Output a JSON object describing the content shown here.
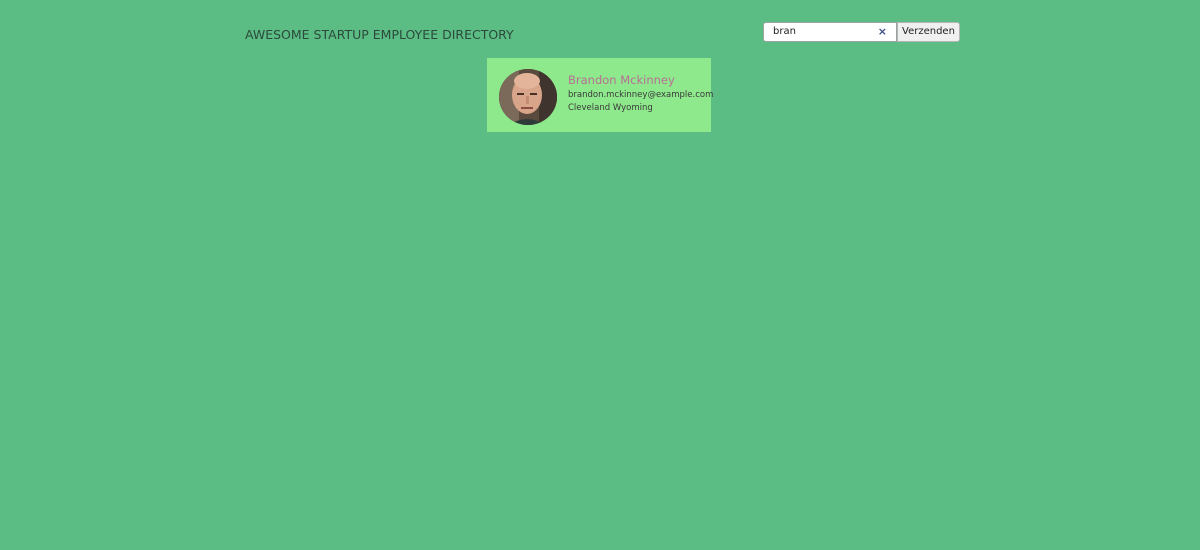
{
  "header": {
    "title": "AWESOME STARTUP EMPLOYEE DIRECTORY"
  },
  "search": {
    "value": "bran",
    "clear_icon": "×",
    "submit_label": "Verzenden"
  },
  "employees": [
    {
      "name": "Brandon Mckinney",
      "email": "brandon.mckinney@example.com",
      "location": "Cleveland Wyoming",
      "avatar": "employee-photo"
    }
  ],
  "colors": {
    "background": "#5bbc84",
    "card_background": "#8ee88c",
    "name_color": "#b86f94",
    "title_color": "#2b4a3c",
    "clear_icon_color": "#3b4d8a"
  }
}
